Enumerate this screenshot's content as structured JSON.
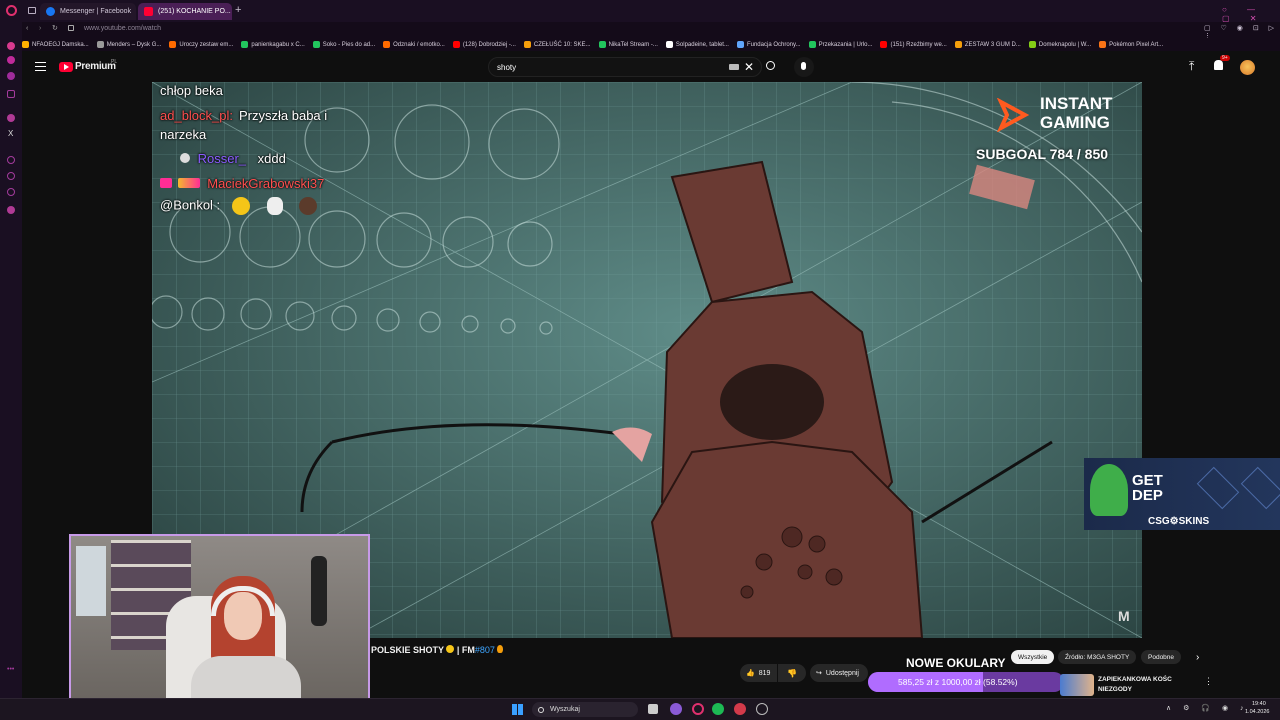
{
  "browser": {
    "tabs": [
      {
        "label": "Messenger | Facebook"
      },
      {
        "label": "(251) KOCHANIE PO..."
      }
    ],
    "url": "www.youtube.com/watch",
    "bookmarks": [
      {
        "label": "NFAOEGJ Damska...",
        "color": "#ffb000"
      },
      {
        "label": "Menders – Dysk G...",
        "color": "#9a9a9a"
      },
      {
        "label": "Uroczy zestaw em...",
        "color": "#ff6a00"
      },
      {
        "label": "panienkagabu x C...",
        "color": "#22c55e"
      },
      {
        "label": "Soko - Pies do ad...",
        "color": "#22c55e"
      },
      {
        "label": "Odznaki / emotko...",
        "color": "#ff6a00"
      },
      {
        "label": "(128) Dobrodziej -...",
        "color": "#ff0000"
      },
      {
        "label": "CZEŁUŚĆ 10: SKE...",
        "color": "#f59e0b"
      },
      {
        "label": "NikaTel Stream -...",
        "color": "#22c55e"
      },
      {
        "label": "Solpadeine, tablet...",
        "color": "#ffffff"
      },
      {
        "label": "Fundacja Ochrony...",
        "color": "#60a5fa"
      },
      {
        "label": "Przekazania | Urlo...",
        "color": "#22c55e"
      },
      {
        "label": "(151) Rzeźbimy we...",
        "color": "#ff0000"
      },
      {
        "label": "ZESTAW 3 GUM D...",
        "color": "#f59e0b"
      },
      {
        "label": "Domeknapolu | W...",
        "color": "#84cc16"
      },
      {
        "label": "Pokémon Pixel Art...",
        "color": "#f97316"
      }
    ]
  },
  "youtube": {
    "logo": "Premium",
    "logo_sup": "PL",
    "search_value": "shoty",
    "notif_badge": "9+"
  },
  "overlay": {
    "chat": [
      {
        "user": "",
        "text": "chłop beka"
      },
      {
        "user": "ad_block_pl:",
        "text": "Przyszła baba i"
      },
      {
        "user": "",
        "text": "narzeka"
      },
      {
        "user": "Rosser_",
        "text": "xddd"
      },
      {
        "user": "MaciekGrabowski37",
        "text": ""
      },
      {
        "user": "@Bonkol :",
        "text": ""
      }
    ],
    "instant_gaming_1": "INSTANT",
    "instant_gaming_2": "GAMING",
    "subgoal": "SUBGOAL 784 / 850",
    "ad_title_1": "GET",
    "ad_title_2": "DEP",
    "ad_brand": "CSG⚙SKINS"
  },
  "video_info": {
    "title": "POLSKIE SHOTY",
    "fm": "| FM",
    "fm_num": "#807",
    "likes": "819",
    "share": "Udostępnij",
    "nowe_okulary": "NOWE OKULARY",
    "goal_text": "585,25 zł z 1000,00 zł (58.52%)",
    "goal_progress": 58.52
  },
  "chips": [
    {
      "label": "Wszystkie"
    },
    {
      "label": "Źródło: M3GA SHOTY"
    },
    {
      "label": "Podobne"
    }
  ],
  "recommended": {
    "title_1": "ZAPIEKANKOWA KOŚC",
    "title_2": "NIEZGODY"
  },
  "taskbar": {
    "search": "Wyszukaj",
    "time": "19:40",
    "date": "1.04.2026"
  },
  "colors": {
    "accent": "#ff2d95",
    "goal_bar": "#b06cff",
    "chat_name_red": "#ff4f4f",
    "chat_name_purple": "#8b5cff"
  }
}
